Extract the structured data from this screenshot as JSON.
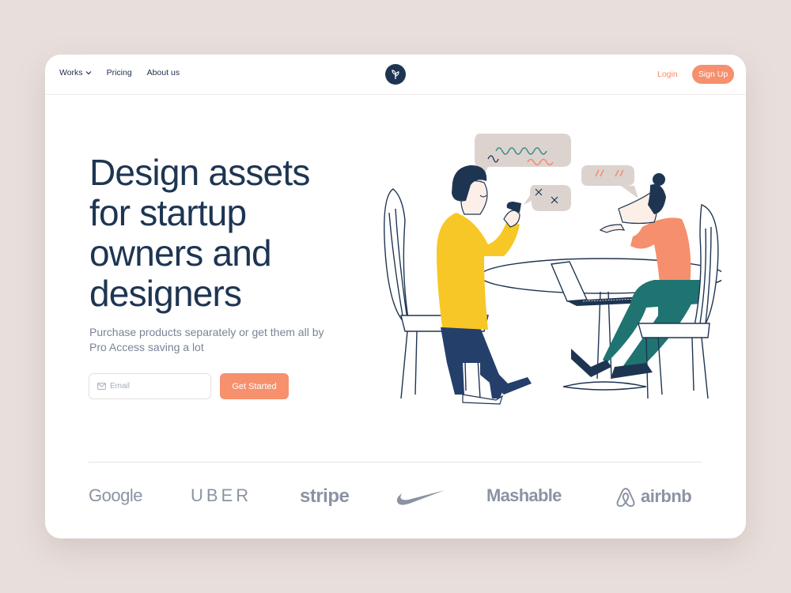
{
  "nav": {
    "links": [
      {
        "label": "Works"
      },
      {
        "label": "Pricing"
      },
      {
        "label": "About us"
      }
    ],
    "login": "Login",
    "signup": "Sign Up"
  },
  "hero": {
    "headline": "Design assets for startup owners and designers",
    "subtitle": "Purchase products separately or get them all by Pro Access saving a lot",
    "email_placeholder": "Email",
    "cta": "Get Started"
  },
  "brands": [
    "Google",
    "UBER",
    "stripe",
    "Nike",
    "Mashable",
    "airbnb"
  ],
  "colors": {
    "accent": "#f6906d",
    "navy": "#1e3552",
    "muted": "#7a8396",
    "background": "#e8dfdc"
  }
}
